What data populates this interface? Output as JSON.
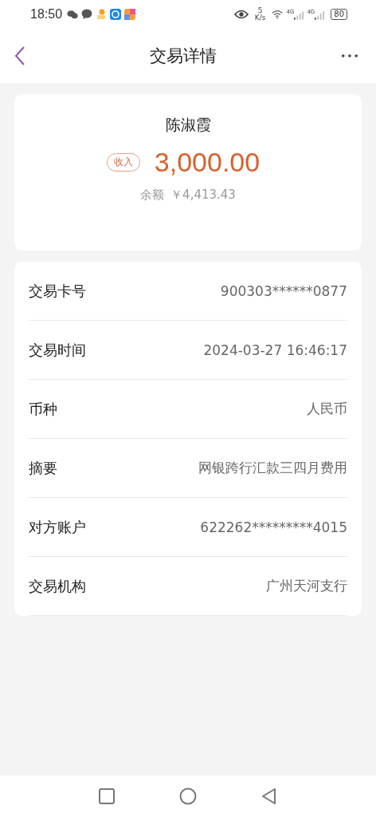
{
  "status_bar": {
    "time": "18:50",
    "speed_value": "5",
    "speed_unit": "K/s",
    "signal_1": "4G",
    "signal_2": "4G",
    "battery": "80"
  },
  "header": {
    "title": "交易详情"
  },
  "summary": {
    "name": "陈淑霞",
    "tag": "收入",
    "amount": "3,000.00",
    "balance_label": "余额",
    "balance": "￥4,413.43"
  },
  "details": [
    {
      "label": "交易卡号",
      "value": "900303******0877"
    },
    {
      "label": "交易时间",
      "value": "2024-03-27 16:46:17"
    },
    {
      "label": "币种",
      "value": "人民币"
    },
    {
      "label": "摘要",
      "value": "网银跨行汇款三四月费用"
    },
    {
      "label": "对方账户",
      "value": "622262*********4015"
    },
    {
      "label": "交易机构",
      "value": "广州天河支行"
    }
  ]
}
